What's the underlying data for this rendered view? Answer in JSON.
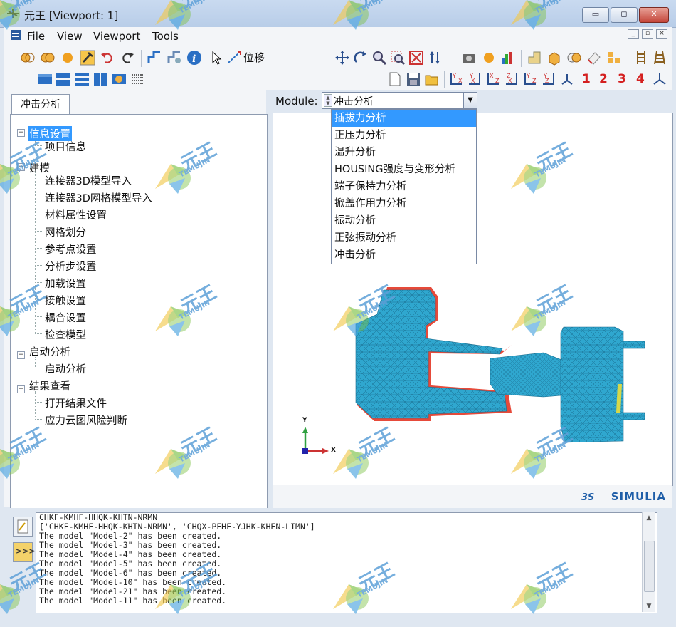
{
  "window": {
    "title": "元王 [Viewport: 1]",
    "min_label": "▭",
    "max_label": "◻",
    "close_label": "✕"
  },
  "menu": [
    {
      "label": "File",
      "mnemonic": "F"
    },
    {
      "label": "View",
      "mnemonic": "V"
    },
    {
      "label": "Viewport",
      "mnemonic": "p"
    },
    {
      "label": "Tools",
      "mnemonic": "T"
    }
  ],
  "toolbar": {
    "displace_label": "位移",
    "view_numbers": [
      "1",
      "2",
      "3",
      "4"
    ],
    "icons": [
      "cut-icon",
      "merge-icon",
      "sphere-icon",
      "tool-icon",
      "undo-icon",
      "redo-icon",
      "query-icon",
      "info-icon",
      "cursor-icon",
      "pan-icon",
      "rotate-icon",
      "zoom-icon",
      "box-zoom-icon",
      "fit-icon",
      "cycle-icon",
      "camera-icon",
      "render-icon",
      "color-icon",
      "new-file-icon",
      "save-icon",
      "open-icon"
    ]
  },
  "left_panel": {
    "tab": "冲击分析",
    "tree": [
      {
        "label": "信息设置",
        "level": 0,
        "selected": true
      },
      {
        "label": "项目信息",
        "level": 1
      },
      {
        "label": "建模",
        "level": 0
      },
      {
        "label": "连接器3D模型导入",
        "level": 1
      },
      {
        "label": "连接器3D网格模型导入",
        "level": 1
      },
      {
        "label": "材料属性设置",
        "level": 1
      },
      {
        "label": "网格划分",
        "level": 1
      },
      {
        "label": "参考点设置",
        "level": 1
      },
      {
        "label": "分析步设置",
        "level": 1
      },
      {
        "label": "加载设置",
        "level": 1
      },
      {
        "label": "接触设置",
        "level": 1
      },
      {
        "label": "耦合设置",
        "level": 1
      },
      {
        "label": "检查模型",
        "level": 1
      },
      {
        "label": "启动分析",
        "level": 0
      },
      {
        "label": "启动分析",
        "level": 1
      },
      {
        "label": "结果查看",
        "level": 0
      },
      {
        "label": "打开结果文件",
        "level": 1
      },
      {
        "label": "应力云图风险判断",
        "level": 1
      }
    ]
  },
  "module": {
    "label": "Module:",
    "value": "冲击分析",
    "options": [
      "插拔力分析",
      "正压力分析",
      "温升分析",
      "HOUSING强度与变形分析",
      "端子保持力分析",
      "掀盖作用力分析",
      "振动分析",
      "正弦振动分析",
      "冲击分析"
    ],
    "highlighted_index": 0
  },
  "viewport": {
    "axis_x": "X",
    "axis_y": "Y",
    "brand": "SIMULIA",
    "mesh_color": "#2fa7cf"
  },
  "console": {
    "lines": [
      "CHKF-KMHF-HHQK-KHTN-NRMN",
      "['CHKF-KMHF-HHQK-KHTN-NRMN', 'CHQX-PFHF-YJHK-KHEN-LIMN']",
      "The model \"Model-2\" has been created.",
      "The model \"Model-3\" has been created.",
      "The model \"Model-4\" has been created.",
      "The model \"Model-5\" has been created.",
      "The model \"Model-6\" has been created.",
      "The model \"Model-10\" has been created.",
      "The model \"Model-21\" has been created.",
      "The model \"Model-11\" has been created."
    ]
  },
  "watermark": {
    "text": "元王",
    "sub": "TEMUJIN"
  }
}
